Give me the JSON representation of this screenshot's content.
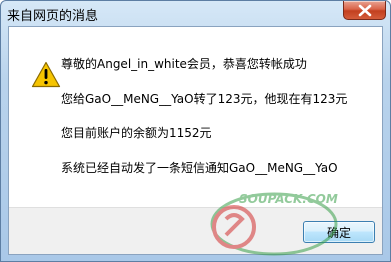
{
  "window": {
    "title": "来自网页的消息"
  },
  "messages": [
    "尊敬的Angel_in_white会员，恭喜您转帐成功",
    "您给GaO__MeNG__YaO转了123元，他现在有123元",
    "您目前账户的余额为1152元",
    "系统已经自动发了一条短信通知GaO__MeNG__YaO"
  ],
  "buttons": {
    "ok_label": "确定"
  },
  "watermark": {
    "text": "SOUPACK.COM"
  },
  "icons": {
    "dialog_icon": "warning-icon",
    "close": "close-icon"
  },
  "colors": {
    "close_button": "#c3401f",
    "warning_fill": "#f6c400",
    "watermark_green": "#3aa04a",
    "watermark_red": "#d23030"
  }
}
